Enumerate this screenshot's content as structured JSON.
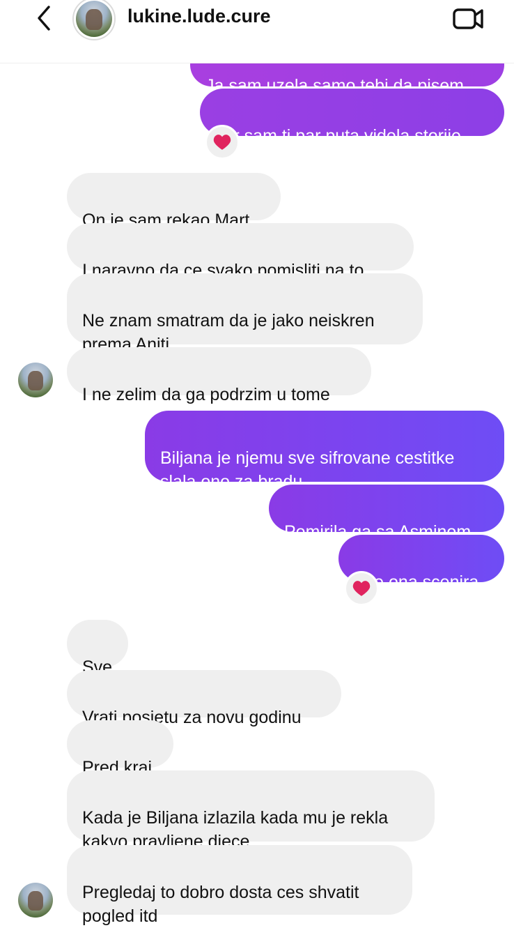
{
  "header": {
    "username": "lukine.lude.cure",
    "back_icon": "chevron-left-icon",
    "video_icon": "video-camera-icon"
  },
  "colors": {
    "outgoing_bubble": "#7a45f0",
    "incoming_bubble": "#efefef",
    "reaction_heart": "#e0245e"
  },
  "messages": [
    {
      "direction": "outgoing",
      "text": "Ja sam uzela samo tebi da pisem"
    },
    {
      "direction": "outgoing",
      "text": "Jer sam ti par puta videla storije",
      "reaction": "❤️"
    },
    {
      "direction": "incoming",
      "text": "On je sam rekao Mart"
    },
    {
      "direction": "incoming",
      "text": "I naravno da ce svako pomisliti  na to"
    },
    {
      "direction": "incoming",
      "text": "Ne znam smatram da je jako neiskren\nprema Aniti"
    },
    {
      "direction": "incoming",
      "text": "I ne zelim da ga podrzim u tome"
    },
    {
      "direction": "outgoing",
      "text": "Biljana je njemu sve sifrovane cestitke\nslala ono za bradu"
    },
    {
      "direction": "outgoing",
      "text": "Pomirila ga sa Asminom"
    },
    {
      "direction": "outgoing",
      "text": "Sve ona scenira",
      "reaction": "❤️"
    },
    {
      "direction": "incoming",
      "text": "Sve"
    },
    {
      "direction": "incoming",
      "text": "Vrati posjetu za novu godinu"
    },
    {
      "direction": "incoming",
      "text": "Pred kraj"
    },
    {
      "direction": "incoming",
      "text": "Kada je Biljana izlazila kada mu je rekla\nkakvo pravljene djece"
    },
    {
      "direction": "incoming",
      "text": "Pregledaj to dobro dosta ces shvatit\npogled itd"
    }
  ]
}
